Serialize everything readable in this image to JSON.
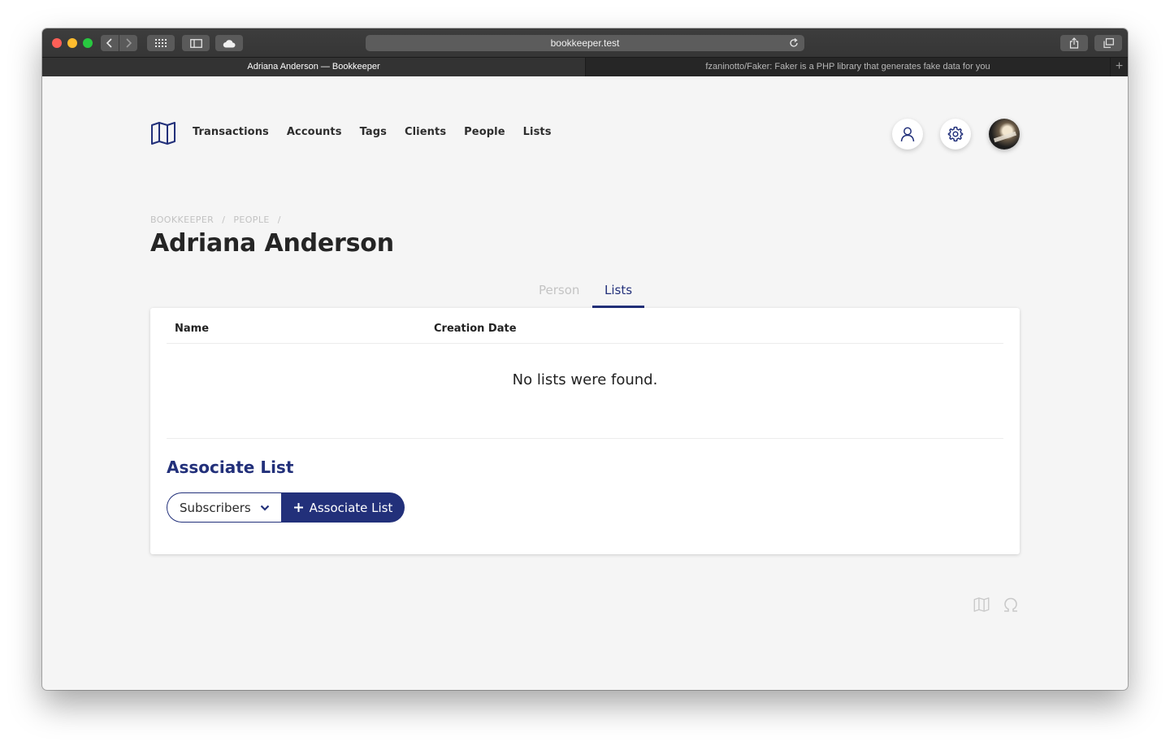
{
  "browser": {
    "url": "bookkeeper.test",
    "tabs": [
      {
        "title": "Adriana Anderson — Bookkeeper",
        "active": true
      },
      {
        "title": "fzaninotto/Faker: Faker is a PHP library that generates fake data for you",
        "active": false
      }
    ]
  },
  "nav": {
    "items": [
      "Transactions",
      "Accounts",
      "Tags",
      "Clients",
      "People",
      "Lists"
    ]
  },
  "breadcrumb": [
    "BOOKKEEPER",
    "/",
    "PEOPLE",
    "/"
  ],
  "page_title": "Adriana Anderson",
  "tabs": {
    "person": "Person",
    "lists": "Lists",
    "active": "Lists"
  },
  "table": {
    "columns": [
      "Name",
      "Creation Date"
    ],
    "empty_message": "No lists were found."
  },
  "associate": {
    "heading": "Associate List",
    "selected_list": "Subscribers",
    "button_label": "Associate List"
  },
  "colors": {
    "accent": "#22307a",
    "page_bg": "#f5f5f5"
  }
}
